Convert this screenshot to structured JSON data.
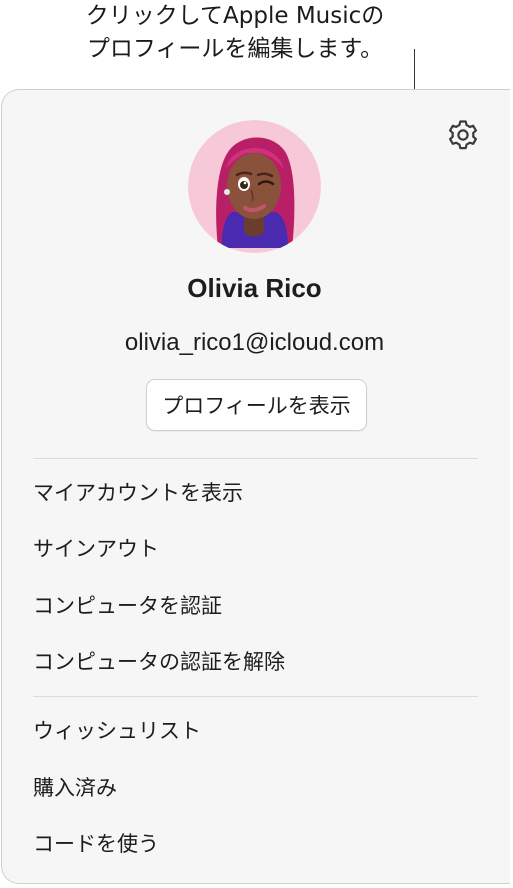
{
  "callout": {
    "line1": "クリックしてApple Musicの",
    "line2": "プロフィールを編集します。"
  },
  "account": {
    "name": "Olivia Rico",
    "email": "olivia_rico1@icloud.com",
    "view_profile_label": "プロフィールを表示"
  },
  "icons": {
    "settings": "gear-icon",
    "avatar": "memoji-avatar"
  },
  "menu": {
    "group1": [
      "マイアカウントを表示",
      "サインアウト",
      "コンピュータを認証",
      "コンピュータの認証を解除"
    ],
    "group2": [
      "ウィッシュリスト",
      "購入済み",
      "コードを使う"
    ]
  },
  "colors": {
    "panel_background": "#f6f6f6",
    "avatar_background": "#f7c9d8",
    "hair": "#c0246e"
  }
}
